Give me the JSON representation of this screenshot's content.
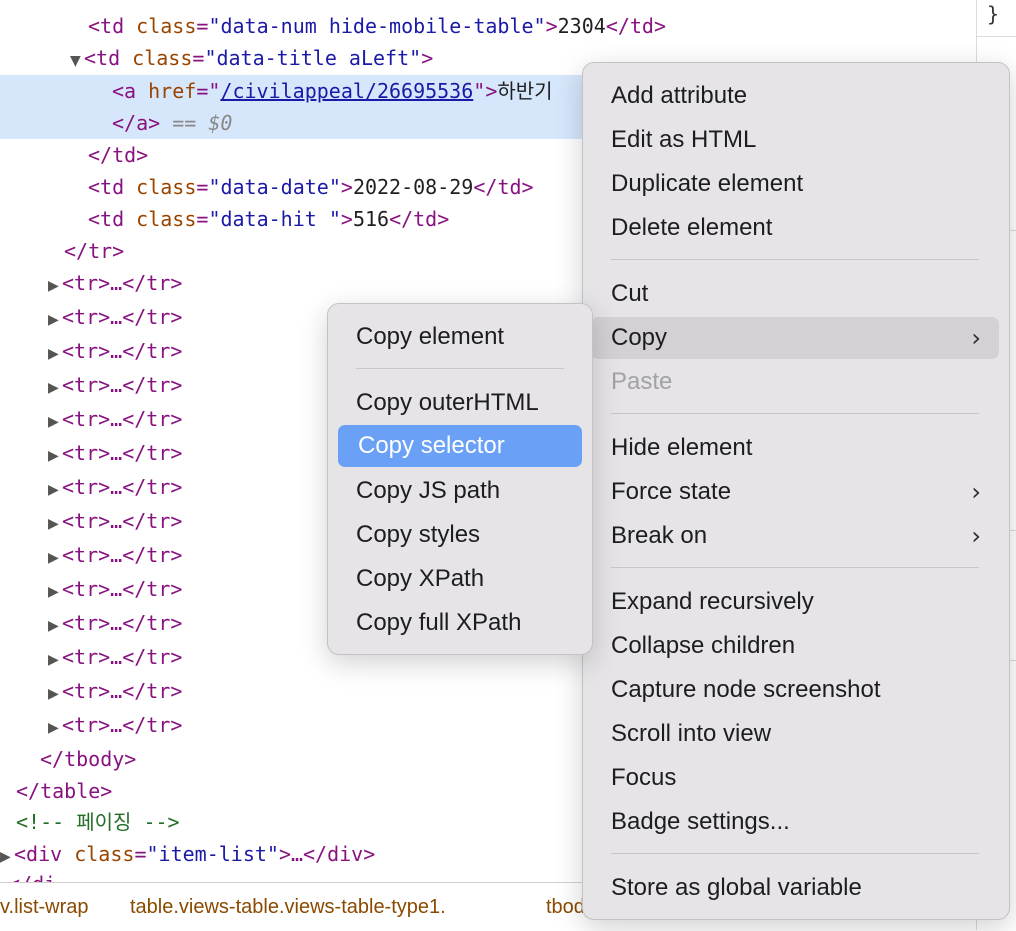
{
  "dom": {
    "td_num": {
      "tag_open": "<td",
      "attr": "class",
      "value": "\"data-num hide-mobile-table\"",
      "close": ">",
      "text": "2304",
      "end": "</td>"
    },
    "td_title": {
      "tag_open": "<td",
      "attr": "class",
      "value": "\"data-title aLeft\"",
      "close": ">"
    },
    "a_line": {
      "tag_open": "<a",
      "attr": "href",
      "eq": "=\"",
      "href": "/civilappeal/26695536",
      "quote_close": "\">",
      "text": "하반기"
    },
    "a_close": {
      "end": "</a>",
      "suffix": " == $0"
    },
    "td_close": "</td>",
    "td_date": {
      "tag_open": "<td",
      "attr": "class",
      "value": "\"data-date\"",
      "close": ">",
      "text": "2022-08-29",
      "end": "</td>"
    },
    "td_hit": {
      "tag_open": "<td",
      "attr": "class",
      "value": "\"data-hit \"",
      "close": ">",
      "text": "516",
      "end": "</td>"
    },
    "tr_close": "</tr>",
    "collapsed_rows": [
      "<tr>…</tr>",
      "<tr>…</tr>",
      "<tr>…</tr>",
      "<tr>…</tr>",
      "<tr>…</tr>",
      "<tr>…</tr>",
      "<tr>…</tr>",
      "<tr>…</tr>",
      "<tr>…</tr>",
      "<tr>…</tr>",
      "<tr>…</tr>",
      "<tr>…</tr>",
      "<tr>…</tr>",
      "<tr>…</tr>"
    ],
    "tbody_close": "</tbody>",
    "table_close": "</table>",
    "comment": "<!-- 페이징 -->",
    "div_item_list": {
      "tag_open": "<div",
      "attr": "class",
      "value": "\"item-list\"",
      "close": ">…</div>"
    },
    "partial_next": "</di"
  },
  "sidebar": {
    "brace": "}"
  },
  "breadcrumbs": {
    "list_wrap": "v.list-wrap",
    "table": "table.views-table.views-table-type1.",
    "tbody": "tbody"
  },
  "context_menu": {
    "items": {
      "add_attribute": "Add attribute",
      "edit_as_html": "Edit as HTML",
      "duplicate_element": "Duplicate element",
      "delete_element": "Delete element",
      "cut": "Cut",
      "copy": "Copy",
      "paste": "Paste",
      "hide_element": "Hide element",
      "force_state": "Force state",
      "break_on": "Break on",
      "expand_recursively": "Expand recursively",
      "collapse_children": "Collapse children",
      "capture_node_screenshot": "Capture node screenshot",
      "scroll_into_view": "Scroll into view",
      "focus": "Focus",
      "badge_settings": "Badge settings...",
      "store_as_global_variable": "Store as global variable"
    }
  },
  "copy_submenu": {
    "items": {
      "copy_element": "Copy element",
      "copy_outerhtml": "Copy outerHTML",
      "copy_selector": "Copy selector",
      "copy_js_path": "Copy JS path",
      "copy_styles": "Copy styles",
      "copy_xpath": "Copy XPath",
      "copy_full_xpath": "Copy full XPath"
    }
  },
  "icons": {
    "expand": "triangle-right-icon",
    "collapse": "triangle-down-icon",
    "submenu": "chevron-right-icon"
  },
  "colors": {
    "selection": "#d6e6fb",
    "menu_bg": "#e6e4e7",
    "menu_active": "#6aa0f6",
    "tag": "#881280",
    "attr": "#994500",
    "value": "#1a1aa6"
  }
}
